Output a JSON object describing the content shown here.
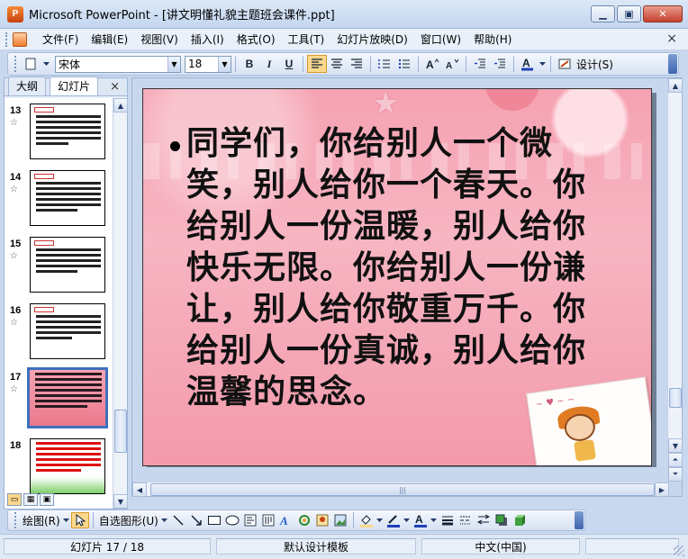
{
  "window": {
    "app_icon_label": "P",
    "title": "Microsoft PowerPoint - [讲文明懂礼貌主题班会课件.ppt]",
    "minimize": "▁",
    "restore": "▣",
    "close": "✕"
  },
  "menu": {
    "items": [
      "文件(F)",
      "编辑(E)",
      "视图(V)",
      "插入(I)",
      "格式(O)",
      "工具(T)",
      "幻灯片放映(D)",
      "窗口(W)",
      "帮助(H)"
    ],
    "close_doc": "×"
  },
  "toolbar": {
    "font": "宋体",
    "size": "18",
    "bold": "B",
    "italic": "I",
    "underline": "U",
    "design": "设计(S)",
    "font_color": "#1f3fb8"
  },
  "left_pane": {
    "tabs": [
      "大纲",
      "幻灯片"
    ],
    "close": "×",
    "slide_numbers": [
      "13",
      "14",
      "15",
      "16",
      "17",
      "18"
    ],
    "star": "☆"
  },
  "slide": {
    "body_text": "同学们，你给别人一个微笑，别人给你一个春天。你给别人一份温暖，别人给你快乐无限。你给别人一份谦让，别人给你敬重万千。你给别人一份真诚，别人给你温馨的思念。",
    "background_color": "#f5a2b2"
  },
  "drawing_toolbar": {
    "draw_menu": "绘图(R)",
    "autoshapes": "自选图形(U)"
  },
  "status": {
    "slide_pos": "幻灯片 17 / 18",
    "template": "默认设计模板",
    "language": "中文(中国)"
  }
}
